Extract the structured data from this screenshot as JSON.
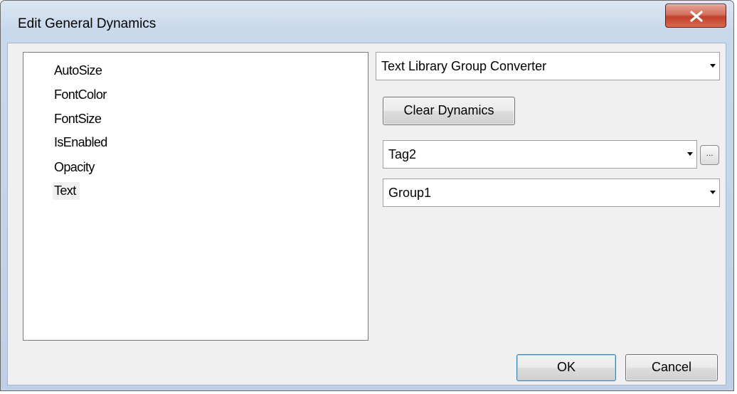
{
  "window": {
    "title": "Edit General Dynamics"
  },
  "property_list": {
    "items": [
      {
        "label": "AutoSize",
        "selected": false
      },
      {
        "label": "FontColor",
        "selected": false
      },
      {
        "label": "FontSize",
        "selected": false
      },
      {
        "label": "IsEnabled",
        "selected": false
      },
      {
        "label": "Opacity",
        "selected": false
      },
      {
        "label": "Text",
        "selected": true
      }
    ]
  },
  "converter_select": {
    "value": "Text Library Group Converter"
  },
  "clear_dynamics_button": {
    "label": "Clear Dynamics"
  },
  "tag_select": {
    "value": "Tag2",
    "browse_button_label": "..."
  },
  "group_select": {
    "value": "Group1"
  },
  "footer": {
    "ok_label": "OK",
    "cancel_label": "Cancel"
  },
  "icons": {
    "close": "close-x-icon",
    "dropdown": "chevron-down-icon"
  }
}
